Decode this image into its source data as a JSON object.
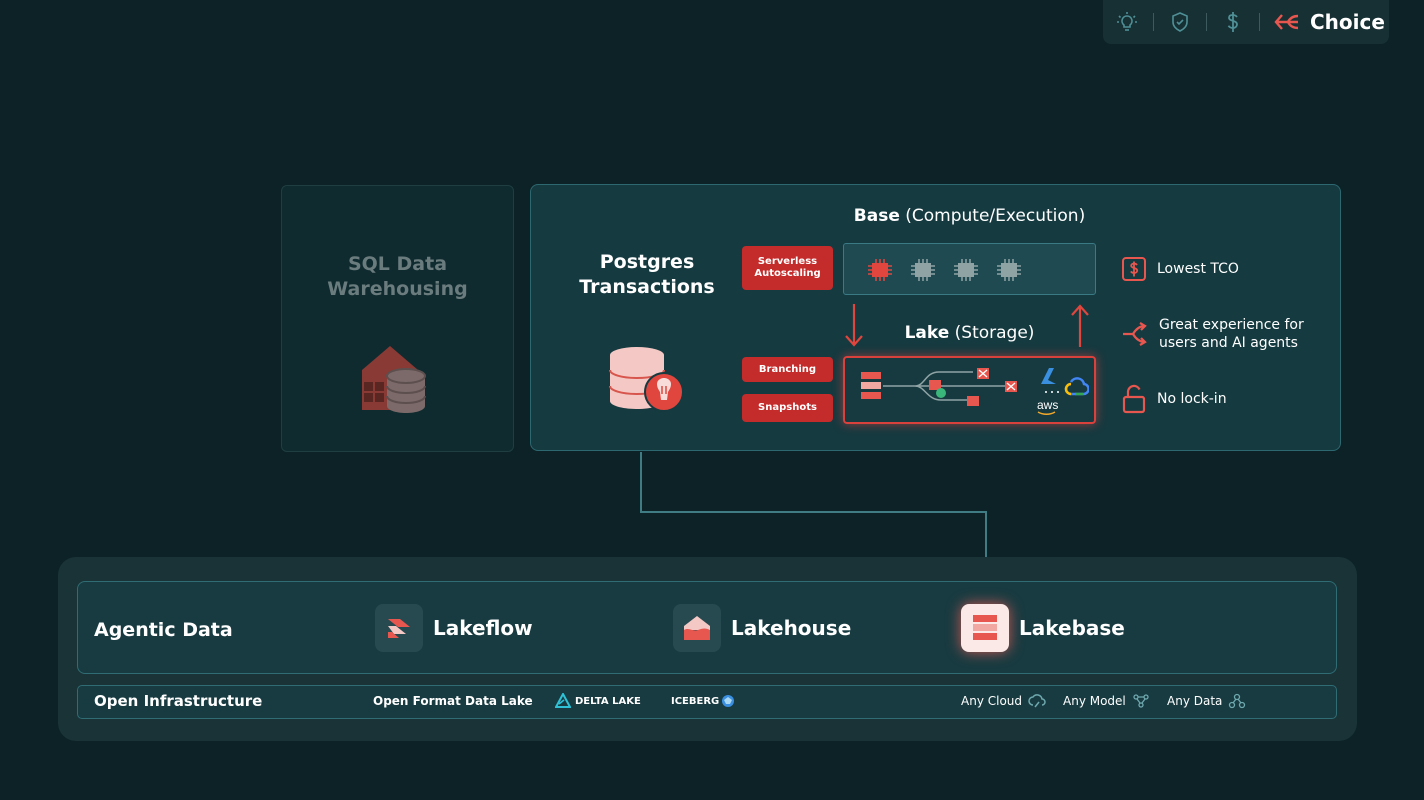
{
  "toolbar": {
    "icons": [
      "lightbulb-icon",
      "shield-icon",
      "dollar-icon",
      "choice-icon"
    ],
    "choice_label": "Choice"
  },
  "sql_panel": {
    "title_line1": "SQL Data",
    "title_line2": "Warehousing"
  },
  "main_panel": {
    "postgres_line1": "Postgres",
    "postgres_line2": "Transactions",
    "base_title_bold": "Base",
    "base_title_rest": " (Compute/Execution)",
    "lake_title_bold": "Lake",
    "lake_title_rest": " (Storage)",
    "serverless_line1": "Serverless",
    "serverless_line2": "Autoscaling",
    "branching": "Branching",
    "snapshots": "Snapshots",
    "aws_label": "aws",
    "features": [
      {
        "icon": "dollar-icon",
        "line1": "Lowest TCO",
        "line2": ""
      },
      {
        "icon": "share-icon",
        "line1": "Great experience for",
        "line2": "users and AI agents"
      },
      {
        "icon": "unlock-icon",
        "line1": "No lock-in",
        "line2": ""
      }
    ]
  },
  "agentic": {
    "label": "Agentic Data",
    "products": [
      {
        "name": "Lakeflow",
        "icon": "lakeflow-icon"
      },
      {
        "name": "Lakehouse",
        "icon": "lakehouse-icon"
      },
      {
        "name": "Lakebase",
        "icon": "lakebase-icon"
      }
    ]
  },
  "infra": {
    "label": "Open Infrastructure",
    "open_format": "Open Format Data Lake",
    "delta_lake": "DELTA LAKE",
    "iceberg": "ICEBERG",
    "any_cloud": "Any Cloud",
    "any_model": "Any Model",
    "any_data": "Any Data"
  },
  "colors": {
    "background": "#0c2226",
    "accent_red": "#c42b2b",
    "icon_red": "#e8574f",
    "panel_border": "#2d6870"
  }
}
